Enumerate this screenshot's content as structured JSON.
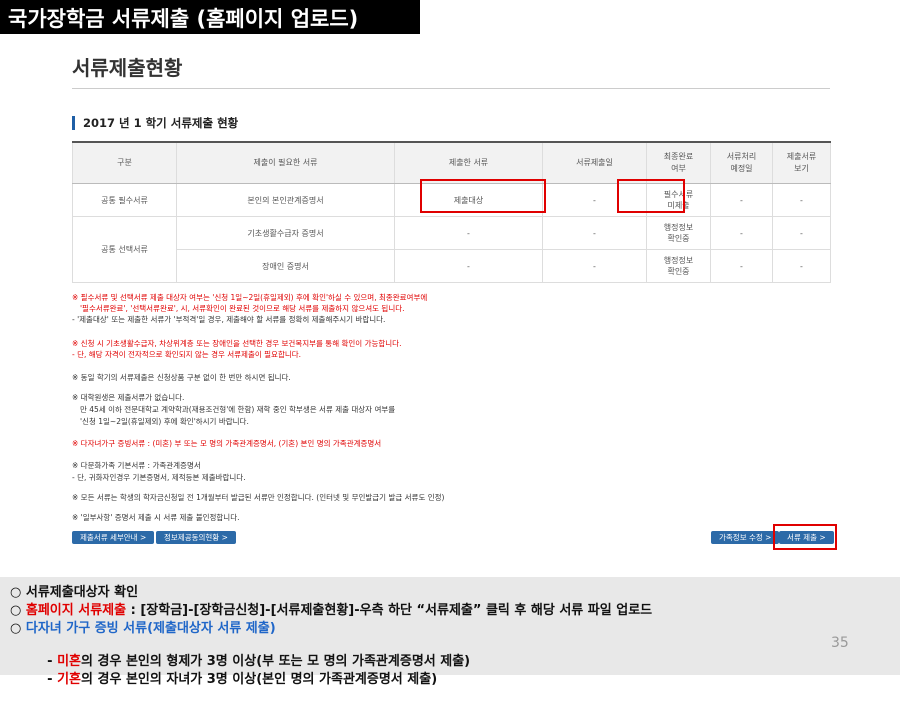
{
  "header": {
    "title": "국가장학금 서류제출 (홈페이지 업로드)"
  },
  "page": {
    "title": "서류제출현황",
    "section_title": "2017 년 1 학기 서류제출 현황"
  },
  "table": {
    "headers": [
      "구분",
      "제출이 필요한 서류",
      "제출한 서류",
      "서류제출일",
      "최종완료\n여부",
      "서류처리\n예정일",
      "제출서류\n보기"
    ],
    "rows": [
      {
        "group": "공통 필수서류",
        "doc": "본인의 본인관계증명서",
        "submitted": "제출대상",
        "date": "-",
        "final": "필수서류\n미제출",
        "process": "-",
        "view": "-"
      },
      {
        "group": "공통 선택서류",
        "doc": "기초생활수급자 증명서",
        "submitted": "-",
        "date": "-",
        "final": "행정정보\n확인중",
        "process": "-",
        "view": "-"
      },
      {
        "group": "",
        "doc": "장애인 증명서",
        "submitted": "-",
        "date": "-",
        "final": "행정정보\n확인중",
        "process": "-",
        "view": "-"
      }
    ]
  },
  "notes": [
    "※ 필수서류 및 선택서류 제출 대상자 여부는 '신청 1일~2일(휴일제외) 후에 확인'하실 수 있으며, 최종완료여부에",
    "'필수서류완료', '선택서류완료', 시, 서류확인이 완료된 것이므로 해당 서류를 제출하지 않으셔도 됩니다.",
    "- '제출대상' 또는 제출한 서류가 '부적격'일 경우, 제출해야 할 서류를 정확히 제출해주시기 바랍니다.",
    "※ 신청 시 기초생활수급자, 차상위계층 또는 장애인을 선택한 경우 보건복지부를 통해 확인이 가능합니다.",
    "- 단, 해당 자격이 전자적으로 확인되지 않는 경우 서류제출이 필요합니다.",
    "※ 동일 학기의 서류제출은 신청상품 구분 없이 한 번만 하시면 됩니다.",
    "※ 대학원생은 제출서류가 없습니다.",
    "만 45세 이하 전문대학교 계약학과(재용조건형'에 한함) 재학 중인 학부생은 서류 제출 대상자 여부를",
    "'신청 1일~2일(휴일제외) 후에 확인'하시기 바랍니다.",
    "※ 다자녀가구 증빙서류 : (미혼) 부 또는 모 명의 가족관계증명서, (기혼) 본인 명의 가족관계증명서",
    "※ 다문화가족 기본서류 : 가족관계증명서",
    "- 단, 귀화자인경우 기본증명서, 제적등본 제출바랍니다.",
    "※ 모든 서류는 학생의 학자금신청일 전 1개월부터 발급된 서류만 인정합니다. (인터넷 및 무인발급기 발급 서류도 인정)",
    "※ '일부사항' 증명서 제출 시 서류 제출 불인정합니다."
  ],
  "buttons": {
    "doc_guide": "제출서류 세부안내 >",
    "info_agree": "정보제공동의현황 >",
    "family_edit": "가족정보 수정 >",
    "doc_submit": "서류 제출 >"
  },
  "bottom": {
    "line1": "○ 서류제출대상자 확인",
    "line2_prefix": "○ ",
    "line2_red": "홈페이지 서류제출",
    "line2_rest": " : [장학금]-[장학금신청]-[서류제출현황]-우측 하단 “서류제출” 클릭 후 해당 서류 파일 업로드",
    "line3_prefix": "○ ",
    "line3_blue": "다자녀 가구 증빙 서류(제출대상자 서류 제출)",
    "line4_prefix": "  - ",
    "line4_red": "미혼",
    "line4_rest": "의 경우 본인의 형제가 3명 이상(부 또는 모 명의 가족관계증명서 제출)",
    "line5_prefix": "  - ",
    "line5_red": "기혼",
    "line5_rest": "의 경우 본인의 자녀가 3명 이상(본인 명의 가족관계증명서 제출)",
    "page_number": "35"
  }
}
